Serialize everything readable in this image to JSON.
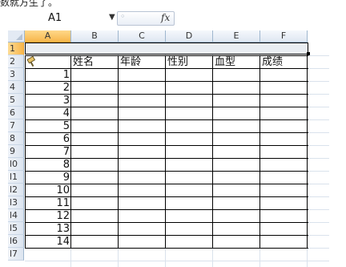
{
  "top_text": "数就方生了。",
  "formula_bar": {
    "name_box": "A1",
    "fx_label": "fx",
    "formula": ""
  },
  "columns": [
    "A",
    "B",
    "C",
    "D",
    "E",
    "F"
  ],
  "selected_column": "A",
  "selected_row": "1",
  "rows": [
    "1",
    "2",
    "3",
    "4",
    "5",
    "6",
    "7",
    "8",
    "9",
    "10",
    "11",
    "12",
    "13",
    "14",
    "15",
    "16",
    "17"
  ],
  "row_labels_visible": [
    "1",
    "2",
    "3",
    "4",
    "5",
    "6",
    "7",
    "8",
    "9",
    "l0",
    "l1",
    "l2",
    "l3",
    "l4",
    "l5",
    "l6",
    "l7"
  ],
  "table": {
    "headers": [
      "姓名",
      "年龄",
      "性别",
      "血型",
      "成绩"
    ],
    "index_values": [
      1,
      2,
      3,
      4,
      5,
      6,
      7,
      8,
      9,
      10,
      11,
      12,
      13,
      14
    ]
  },
  "watermark": "",
  "colors": {
    "selected_header": "#f7b64b",
    "header_bg": "#dfe7f2",
    "gridline": "#dae2ec",
    "border": "#000000"
  },
  "icons": {
    "name_dropdown": "chevron-down-icon",
    "paint_format": "paint-brush-icon",
    "select_all": "select-all-icon"
  }
}
